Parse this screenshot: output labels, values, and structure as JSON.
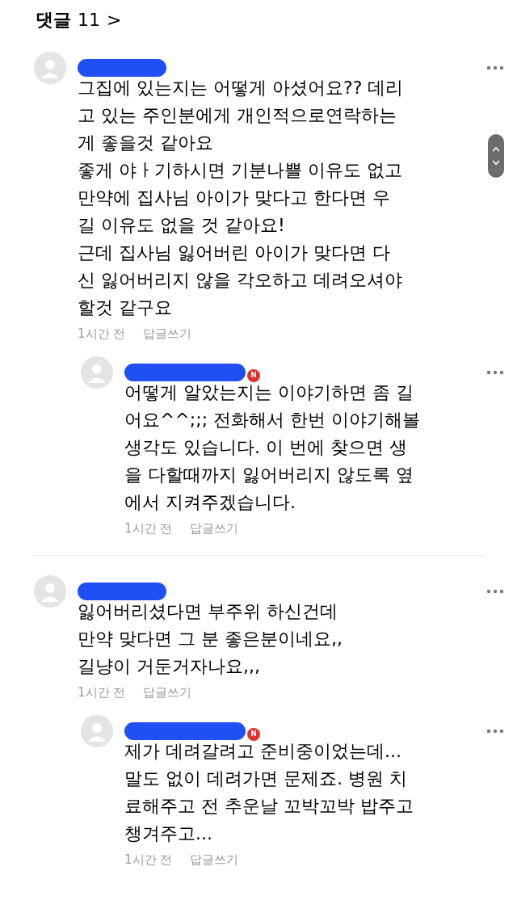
{
  "header": {
    "title": "댓글",
    "count": "11",
    "chevron": ">"
  },
  "threads": [
    {
      "comment": {
        "body": "그집에 있는지는 어떻게 아셨어요?? 데리\n고 있는 주인분에게 개인적으로연락하는\n게 좋을것 같아요\n좋게 야ㅏ기하시면 기분나쁠 이유도 없고\n만약에 집사님 아이가 맞다고 한다면 우\n길 이유도 없을 것 같아요!\n근데 집사님 잃어버린 아이가 맞다면 다\n신 잃어버리지 않을 각오하고 데려오셔야\n할것 같구요",
        "time": "1시간 전",
        "reply": "답글쓰기"
      },
      "replies": [
        {
          "badge": "N",
          "body": "어떻게 알았는지는 이야기하면 좀 길\n어요^^;;; 전화해서 한번 이야기해볼\n생각도 있습니다. 이 번에 찾으면 생\n을 다할때까지 잃어버리지 않도록 옆\n에서 지켜주겠습니다.",
          "time": "1시간 전",
          "reply": "답글쓰기"
        }
      ]
    },
    {
      "comment": {
        "body": "잃어버리셨다면 부주위 하신건데\n만약 맞다면 그 분 좋은분이네요,,\n길냥이 거둔거자나요,,,",
        "time": "1시간 전",
        "reply": "답글쓰기"
      },
      "replies": [
        {
          "badge": "N",
          "body": "제가 데려갈려고 준비중이었는데...\n말도 없이 데려가면 문제죠. 병원 치\n료해주고 전 추운날 꼬박꼬박 밥주고\n챙겨주고...",
          "time": "1시간 전",
          "reply": "답글쓰기"
        }
      ]
    }
  ]
}
